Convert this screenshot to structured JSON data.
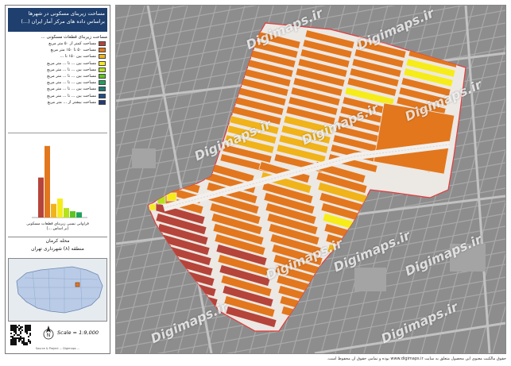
{
  "panel": {
    "title_line1": "مساحت زیربنای مسکونی در شهرها",
    "title_line2": "براساس داده های مرکز آمار ایران (...)",
    "legend_heading": "مساحت زیربنای قطعات مسکونی ...",
    "legend": [
      {
        "label": "مساحت کمتر از ۵۰ متر مربع",
        "color": "#b5443a"
      },
      {
        "label": "مساحت ۵۰ تا ۱۵۰ متر مربع",
        "color": "#e2771e"
      },
      {
        "label": "مساحت بین ۱۵۰ تا ...",
        "color": "#f1b31a"
      },
      {
        "label": "مساحت بین ... تا ... متر مربع",
        "color": "#f6ec1a"
      },
      {
        "label": "مساحت بین ... تا ... متر مربع",
        "color": "#b4e21b"
      },
      {
        "label": "مساحت بین ... تا ... متر مربع",
        "color": "#5ec41f"
      },
      {
        "label": "مساحت بین ... تا ... متر مربع",
        "color": "#1ea35a"
      },
      {
        "label": "مساحت بین ... تا ... متر مربع",
        "color": "#1b7a78"
      },
      {
        "label": "مساحت بین ... تا ... متر مربع",
        "color": "#1e4f86"
      },
      {
        "label": "مساحت بیشتر از ... متر مربع",
        "color": "#243a7a"
      }
    ],
    "histogram_caption_1": "فراوانی نسبی زیربنای قطعات مسکونی",
    "histogram_caption_2": "(بر اساس ...)",
    "histogram_values": [
      0.38,
      0.68,
      0.13,
      0.18,
      0.09,
      0.06,
      0.05
    ],
    "location_line1": "محله کرمان",
    "location_line2": "منطقه (۸) شهرداری تهران",
    "scale": "Scale = 1:9,000",
    "credit": "Source & Project ... Digimaps ...",
    "north_label": "N"
  },
  "map": {
    "watermark": "Digimaps.ir"
  },
  "bottom_note": "حقوق مالکیت معنوی این محصول متعلق به سایت www.digimaps.ir بوده و تمامی حقوق آن محفوظ است."
}
